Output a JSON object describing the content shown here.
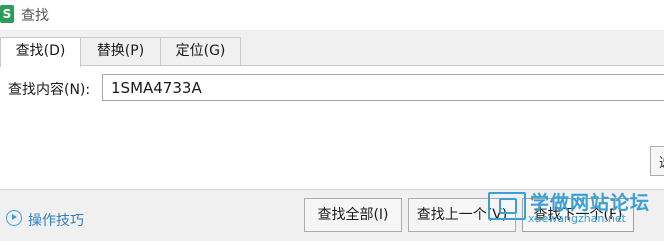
{
  "window": {
    "app_icon_letter": "S",
    "title": "查找"
  },
  "tabs": [
    {
      "label": "查找(D)",
      "active": true
    },
    {
      "label": "替换(P)",
      "active": false
    },
    {
      "label": "定位(G)",
      "active": false
    }
  ],
  "find": {
    "label": "查找内容(N):",
    "value": "1SMA4733A"
  },
  "options_button": {
    "label": "选"
  },
  "tips": {
    "label": "操作技巧",
    "icon": "play-circle-icon"
  },
  "buttons": {
    "find_all": "查找全部(I)",
    "find_prev": "查找上一个(V)",
    "find_next": "查找下一个(F)"
  },
  "watermark": {
    "main": "学做网站论坛",
    "sub": "xuewangzhan.net"
  },
  "colors": {
    "accent": "#3a9fd6",
    "app_icon": "#2d9c5a",
    "link": "#2f7fc1"
  }
}
